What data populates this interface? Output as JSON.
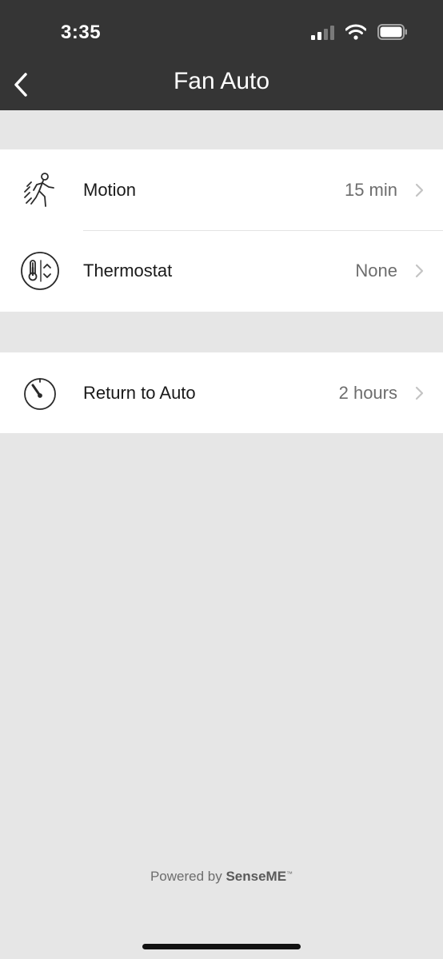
{
  "status_bar": {
    "time": "3:35",
    "icons": [
      "cellular-signal-icon",
      "wifi-icon",
      "battery-icon"
    ]
  },
  "nav": {
    "title": "Fan Auto",
    "back_icon": "chevron-left-icon"
  },
  "groups": [
    {
      "rows": [
        {
          "icon": "motion-walking-person-icon",
          "label": "Motion",
          "value": "15 min"
        },
        {
          "icon": "thermostat-icon",
          "label": "Thermostat",
          "value": "None"
        }
      ]
    },
    {
      "rows": [
        {
          "icon": "timer-dial-icon",
          "label": "Return to Auto",
          "value": "2 hours"
        }
      ]
    }
  ],
  "footer": {
    "prefix": "Powered by",
    "brand": "SenseME",
    "trademark": "™"
  },
  "colors": {
    "header_bg": "#353535",
    "page_bg": "#e6e6e6",
    "row_bg": "#ffffff",
    "value_text": "#6d6d6d",
    "chevron": "#c4c4c4"
  }
}
